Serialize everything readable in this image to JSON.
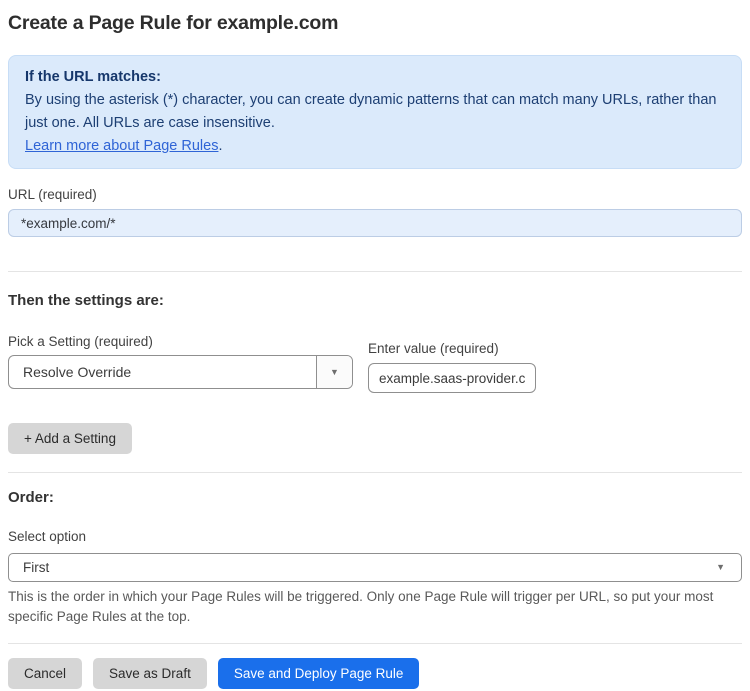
{
  "page": {
    "title": "Create a Page Rule for example.com"
  },
  "info_box": {
    "heading": "If the URL matches:",
    "body": "By using the asterisk (*) character, you can create dynamic patterns that can match many URLs, rather than just one. All URLs are case insensitive.",
    "link_label": "Learn more about Page Rules",
    "link_suffix": "."
  },
  "url_field": {
    "label": "URL (required)",
    "value": "*example.com/*"
  },
  "settings_section": {
    "heading": "Then the settings are:",
    "setting_picker": {
      "label": "Pick a Setting (required)",
      "selected": "Resolve Override",
      "arrow_icon": "▼"
    },
    "value_field": {
      "label": "Enter value (required)",
      "value": "example.saas-provider.c"
    },
    "add_setting_button": "+ Add a Setting"
  },
  "order_section": {
    "heading": "Order:",
    "select_label": "Select option",
    "selected": "First",
    "arrow_icon": "▼",
    "help_text": "This is the order in which your Page Rules will be triggered. Only one Page Rule will trigger per URL, so put your most specific Page Rules at the top."
  },
  "footer": {
    "cancel_label": "Cancel",
    "save_draft_label": "Save as Draft",
    "save_deploy_label": "Save and Deploy Page Rule"
  },
  "colors": {
    "accent_blue": "#1a6feb",
    "info_box_background": "#dbeafb",
    "info_box_text": "#1d3f73",
    "link_blue": "#2f64d6",
    "url_input_background": "#e5effc",
    "gray_button_background": "#d6d6d6"
  }
}
